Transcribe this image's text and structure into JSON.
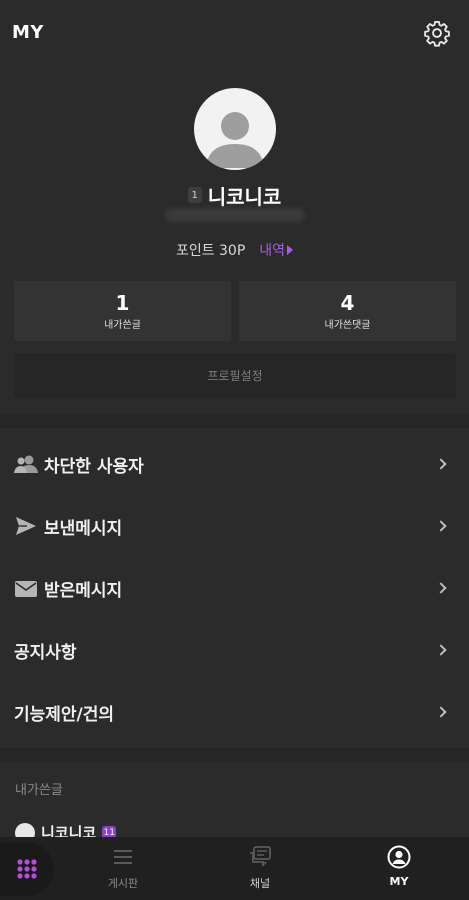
{
  "header": {
    "title": "MY",
    "settings_icon": "gear-icon"
  },
  "profile": {
    "avatar_icon": "default-user-avatar",
    "level": "1",
    "nickname": "니코니코",
    "points_text": "포인트 30P",
    "history_link": "내역"
  },
  "stats": [
    {
      "value": "1",
      "label": "내가쓴글"
    },
    {
      "value": "4",
      "label": "내가쓴댓글"
    }
  ],
  "profile_settings_label": "프로필설정",
  "menu": [
    {
      "label": "차단한 사용자",
      "icon": "blocked-users-icon"
    },
    {
      "label": "보낸메시지",
      "icon": "send-icon"
    },
    {
      "label": "받은메시지",
      "icon": "mail-icon"
    },
    {
      "label": "공지사항",
      "icon": ""
    },
    {
      "label": "기능제안/건의",
      "icon": ""
    }
  ],
  "my_posts": {
    "title": "내가쓴글",
    "author": "니코니코",
    "author_level": "11"
  },
  "bottom_nav": {
    "apps_icon": "grid-icon",
    "tabs": [
      {
        "label": "게시판",
        "icon": "list-icon",
        "active": false
      },
      {
        "label": "채널",
        "icon": "chat-icon",
        "active": false
      },
      {
        "label": "MY",
        "icon": "user-icon",
        "active": true
      }
    ]
  },
  "colors": {
    "background": "#2b2b2b",
    "accent_purple": "#a45de6",
    "grid_icon_purple": "#b44dd9",
    "nav_background": "#202020"
  }
}
